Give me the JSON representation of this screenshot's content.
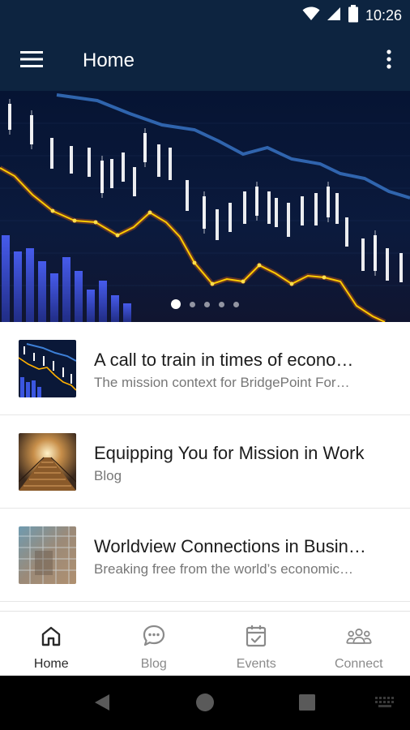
{
  "status_bar": {
    "time": "10:26",
    "icons": [
      "wifi-icon",
      "cell-signal-icon",
      "battery-icon"
    ]
  },
  "app_bar": {
    "title": "Home",
    "menu_icon": "hamburger-menu-icon",
    "overflow_icon": "more-vertical-icon"
  },
  "carousel": {
    "slide_count": 5,
    "active_index": 0
  },
  "list": [
    {
      "title": "A call to train in times of econo…",
      "subtitle": "The mission context for BridgePoint For…"
    },
    {
      "title": "Equipping You for Mission in Work",
      "subtitle": "Blog"
    },
    {
      "title": "Worldview Connections in Busin…",
      "subtitle": "Breaking free from the world’s economic…"
    }
  ],
  "bottom_nav": [
    {
      "label": "Home",
      "icon": "home-icon",
      "active": true
    },
    {
      "label": "Blog",
      "icon": "chat-bubble-icon",
      "active": false
    },
    {
      "label": "Events",
      "icon": "calendar-check-icon",
      "active": false
    },
    {
      "label": "Connect",
      "icon": "people-group-icon",
      "active": false
    }
  ],
  "colors": {
    "app_bar": "#0d2440",
    "nav_active": "#2a2a2a",
    "nav_inactive": "#8a8a8a",
    "subtitle": "#777777"
  }
}
